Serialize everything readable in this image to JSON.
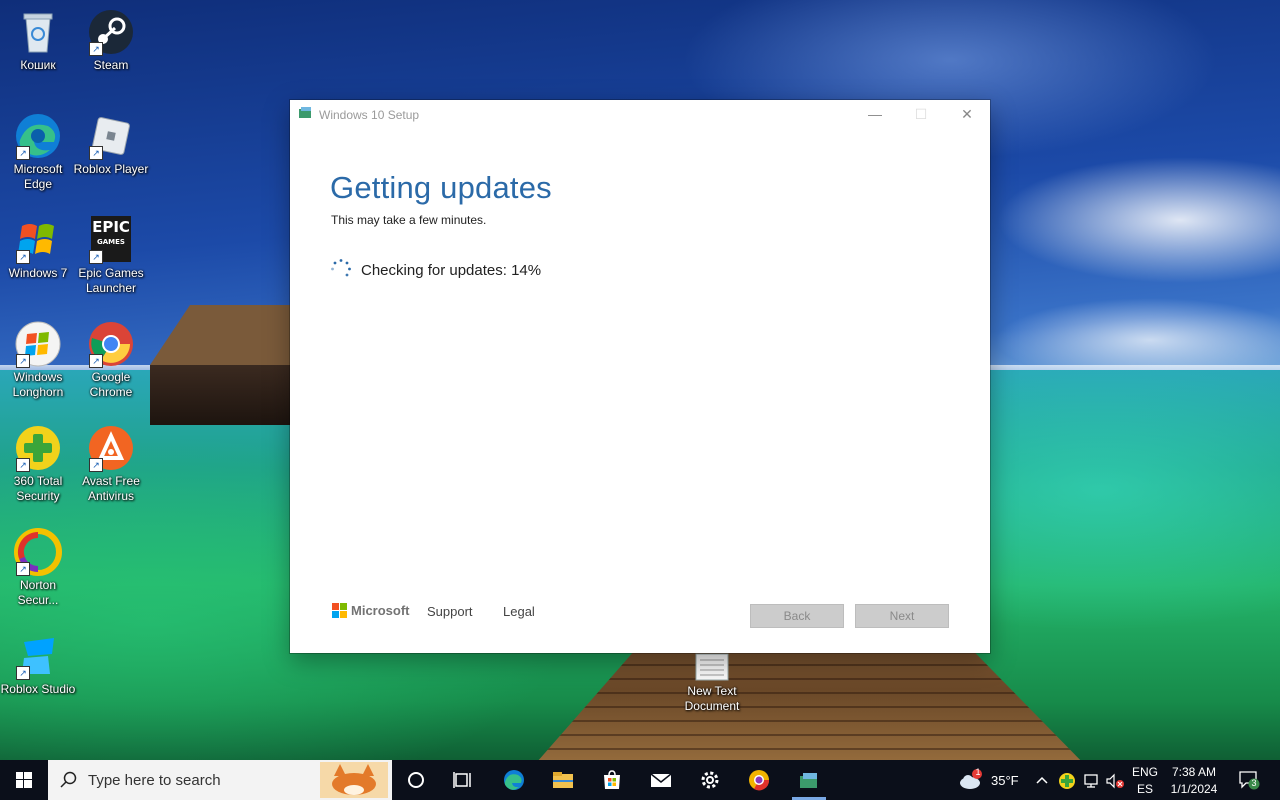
{
  "desktop": {
    "icons": [
      {
        "label": "Кошик",
        "icon": "recycle-bin-icon"
      },
      {
        "label": "Steam",
        "icon": "steam-icon"
      },
      {
        "label": "Microsoft Edge",
        "icon": "edge-icon"
      },
      {
        "label": "Roblox Player",
        "icon": "roblox-icon"
      },
      {
        "label": "Windows 7",
        "icon": "windows7-icon"
      },
      {
        "label": "Epic Games Launcher",
        "icon": "epic-games-icon"
      },
      {
        "label": "Windows Longhorn",
        "icon": "windows-longhorn-icon"
      },
      {
        "label": "Google Chrome",
        "icon": "chrome-icon"
      },
      {
        "label": "360 Total Security",
        "icon": "360-security-icon"
      },
      {
        "label": "Avast Free Antivirus",
        "icon": "avast-icon"
      },
      {
        "label": "Norton Secur...",
        "icon": "norton-icon"
      },
      {
        "label": "Roblox Studio",
        "icon": "roblox-studio-icon"
      },
      {
        "label": "New Text Document",
        "icon": "text-document-icon"
      }
    ],
    "epic_logo_text": "EPIC",
    "epic_logo_sub": "GAMES"
  },
  "window": {
    "title": "Windows 10 Setup",
    "minimize": "—",
    "maximize": "☐",
    "close": "✕",
    "heading": "Getting updates",
    "subheading": "This may take a few minutes.",
    "status_text": "Checking for updates: 14%",
    "progress_percent": 14,
    "footer": {
      "brand": "Microsoft",
      "support_link": "Support",
      "legal_link": "Legal",
      "back_button": "Back",
      "next_button": "Next",
      "buttons_enabled": false
    }
  },
  "taskbar": {
    "search_placeholder": "Type here to search",
    "pinned": [
      "cortana-circle-icon",
      "task-view-icon",
      "edge-icon",
      "file-explorer-icon",
      "microsoft-store-icon",
      "mail-icon",
      "settings-gear-icon",
      "chrome-canary-icon",
      "windows-setup-icon"
    ],
    "weather": {
      "temperature": "35°F",
      "alert_count": "1"
    },
    "language": {
      "primary": "ENG",
      "secondary": "ES"
    },
    "clock": {
      "time": "7:38 AM",
      "date": "1/1/2024"
    },
    "notifications_count": "3",
    "accent_color": "#7aa9e6"
  },
  "colors": {
    "heading": "#2b6aa8",
    "button_disabled_bg": "#cccccc",
    "taskbar_bg": "#0b0f1a"
  }
}
